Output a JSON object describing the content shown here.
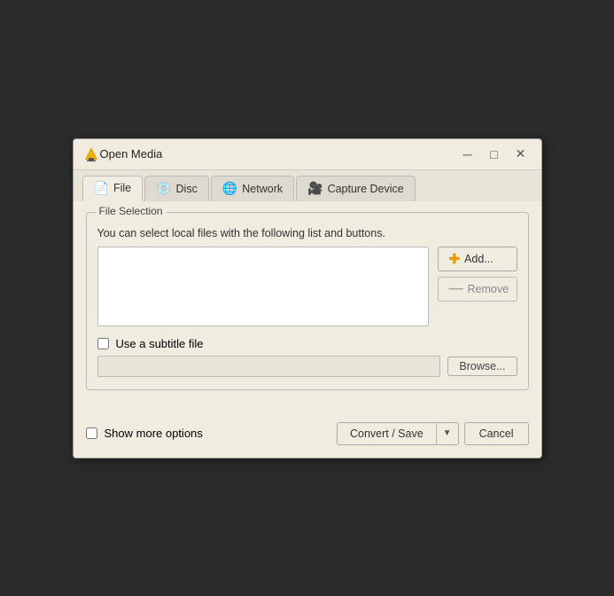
{
  "window": {
    "title": "Open Media",
    "minimize_label": "─",
    "maximize_label": "□",
    "close_label": "✕"
  },
  "tabs": [
    {
      "id": "file",
      "label": "File",
      "active": true
    },
    {
      "id": "disc",
      "label": "Disc",
      "active": false
    },
    {
      "id": "network",
      "label": "Network",
      "active": false
    },
    {
      "id": "capture",
      "label": "Capture Device",
      "active": false
    }
  ],
  "file_selection": {
    "section_label": "File Selection",
    "description": "You can select local files with the following list and buttons.",
    "add_button": "Add...",
    "remove_button": "Remove"
  },
  "subtitle": {
    "checkbox_label": "Use a subtitle file",
    "browse_button": "Browse..."
  },
  "bottom": {
    "show_more_label": "Show more options",
    "convert_button": "Convert / Save",
    "cancel_button": "Cancel"
  }
}
